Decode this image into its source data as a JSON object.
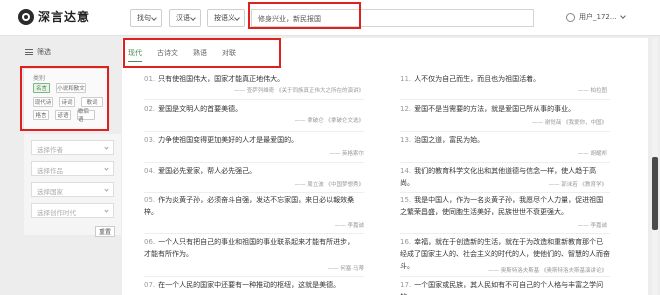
{
  "header": {
    "logo": "深言达意",
    "find_select": "找句",
    "lang_select": "汉语",
    "mode_select": "按语义",
    "search_value": "修身兴业，新民报国",
    "user_label": "用户_172..."
  },
  "sidebar": {
    "title": "筛选",
    "category_label": "类别",
    "categories": [
      "名言",
      "小说和散文",
      "现代诗",
      "诗词",
      "歌词",
      "格言",
      "谚语",
      "歇后语"
    ],
    "author_placeholder": "选择作者",
    "work_placeholder": "选择作品",
    "country_placeholder": "选择国家",
    "era_placeholder": "选择创作时代",
    "reset_label": "重置"
  },
  "tabs": [
    "现代",
    "古诗文",
    "熟语",
    "对联"
  ],
  "quotes_left": [
    {
      "num": "01.",
      "text": "只有使祖国伟大，国家才能真正地伟大。",
      "source": "—— 查萨列维奇 《关于同族真正伟大之所在的演讲》"
    },
    {
      "num": "02.",
      "text": "爱国是文明人的首要美德。",
      "source": "—— 拿破仑 《拿破仑文选》"
    },
    {
      "num": "03.",
      "text": "力争使祖国变得更加美好的人才是最爱国的。",
      "source": "—— 英格索尔"
    },
    {
      "num": "04.",
      "text": "爱国必先爱家，帮人必先强己。",
      "source": "—— 周立波 《中国梦想秀》"
    },
    {
      "num": "05.",
      "text": "作为炎黄子孙，必须奋斗自强，发达不忘家国，来日必以報效桑梓。",
      "source": "—— 李嘉诚"
    },
    {
      "num": "06.",
      "text": "一个人只有把自己的事业和祖国的事业联系起来才能有所进步，才能有所作为。",
      "source": "—— 何塞·马蒂"
    },
    {
      "num": "07.",
      "text": "在一个人民的国家中还要有一种推动的枢纽，这就是美德。",
      "source": ""
    }
  ],
  "quotes_right": [
    {
      "num": "11.",
      "text": "人不仅为自己而生，而且也为祖国活着。",
      "source": "—— 柏拉图"
    },
    {
      "num": "12.",
      "text": "爱国不是当需要的方法，就是爱国已所从事的事业。",
      "source": "—— 谢觉哉 《我爱你，中国》"
    },
    {
      "num": "13.",
      "text": "治国之道，富民为始。",
      "source": "—— 胡耀邦"
    },
    {
      "num": "14.",
      "text": "我们的教育科学文化出和其他道德与信念一样，使人趋于高尚。",
      "source": "—— 郭沫若 《教育学》"
    },
    {
      "num": "15.",
      "text": "我是中国人，作为一名炎黄子孙，我愿尽个人力量，促进祖国之繁荣昌盛，使同胞生活美好，民族世世不衰更强大。",
      "source": "—— 李嘉诚"
    },
    {
      "num": "16.",
      "text": "幸福，就在于创造新的生活，就在于为改造和重新教育那个已经成了国家主人的、社会主义的时代的人，使他们的、智慧的人而奋斗。",
      "source": "—— 奥斯特洛夫斯基 《奥斯特洛夫斯基演讲论》"
    },
    {
      "num": "17.",
      "text": "一个国家或民族，其人民如有不可自己的个人格与丰富之学问的。",
      "source": ""
    }
  ]
}
